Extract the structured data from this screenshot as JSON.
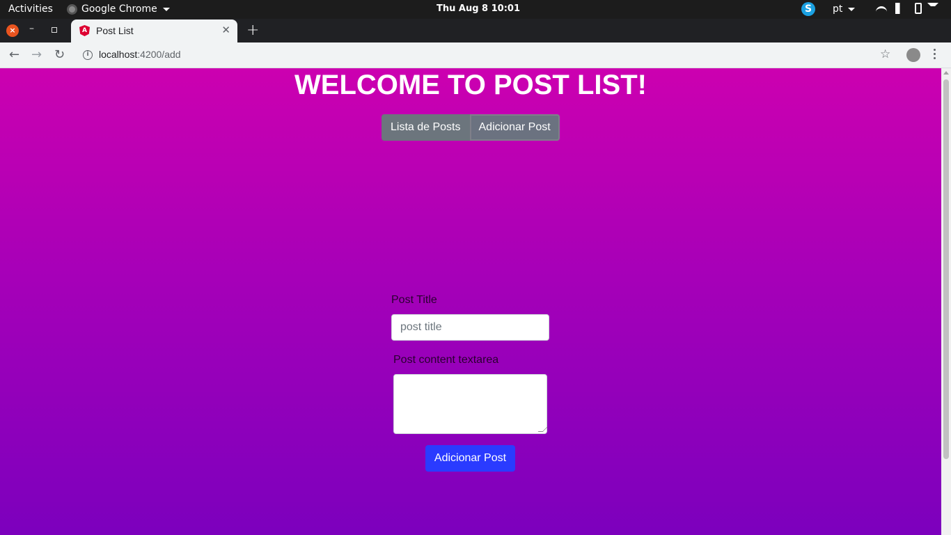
{
  "os_topbar": {
    "activities": "Activities",
    "app_name": "Google Chrome",
    "clock": "Thu Aug 8  10:01",
    "language": "pt",
    "skype_letter": "S"
  },
  "browser": {
    "tab_title": "Post List",
    "favicon_letter": "A",
    "url_host": "localhost",
    "url_path": ":4200/add"
  },
  "page": {
    "heading": "WELCOME TO POST LIST!",
    "nav_buttons": [
      "Lista de Posts",
      "Adicionar Post"
    ],
    "form": {
      "title_label": "Post Title",
      "title_placeholder": "post title",
      "content_label": "Post content textarea",
      "submit_label": "Adicionar Post"
    }
  },
  "colors": {
    "gradient_top": "#cc00b0",
    "gradient_bottom": "#7c00bd",
    "submit_button": "#2a3bff",
    "nav_button": "#6c757d"
  }
}
